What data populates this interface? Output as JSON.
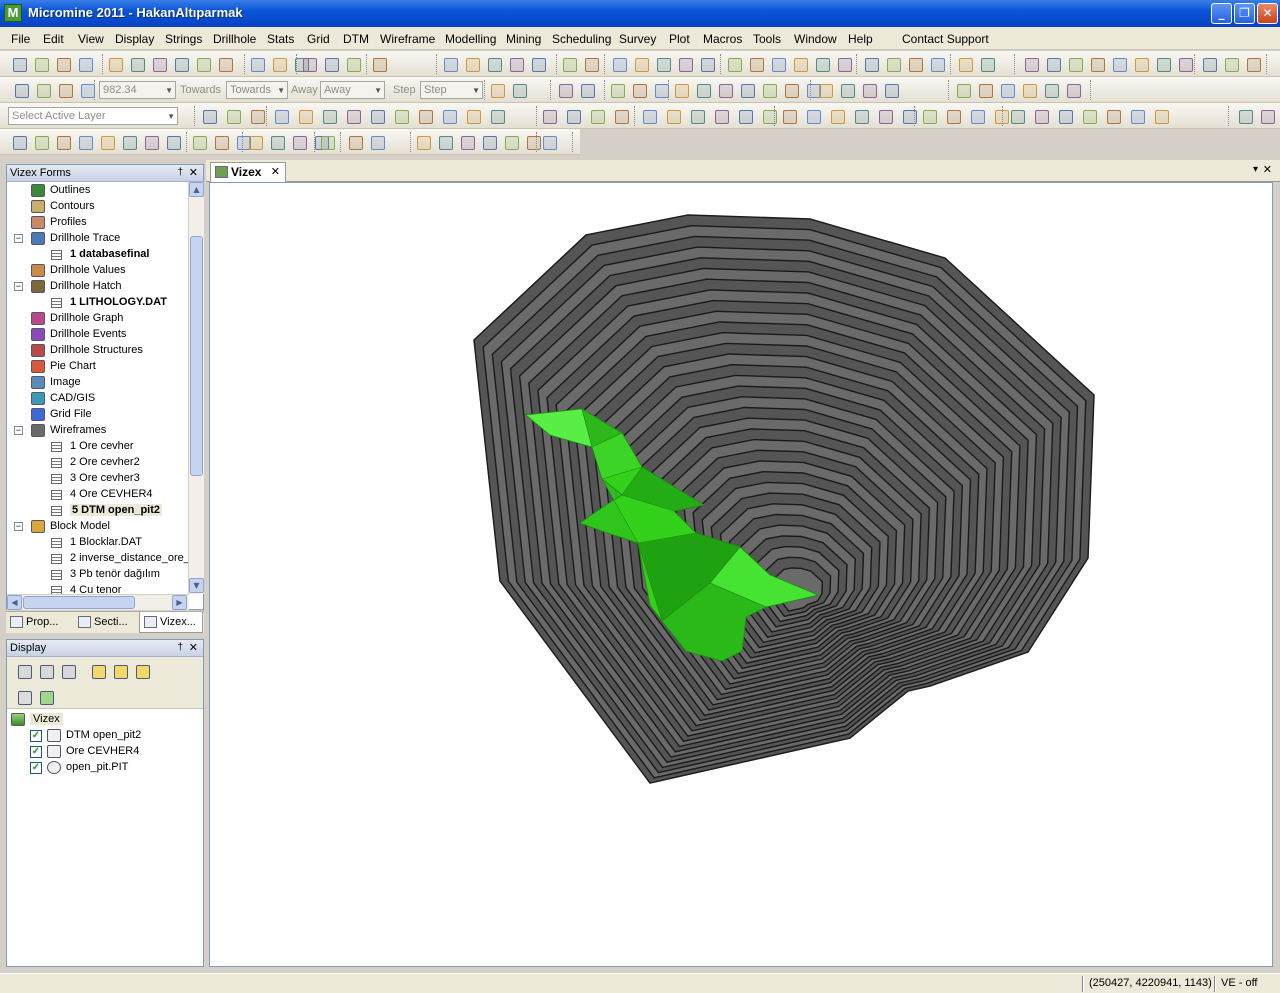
{
  "window": {
    "title": "Micromine 2011 - HakanAltıparmak",
    "app_icon_letter": "M",
    "minimize": "_",
    "maximize": "❐",
    "close": "✕"
  },
  "menu": [
    "File",
    "Edit",
    "View",
    "Display",
    "Strings",
    "Drillhole",
    "Stats",
    "Grid",
    "DTM",
    "Wireframe",
    "Modelling",
    "Mining",
    "Scheduling",
    "Survey",
    "Plot",
    "Macros",
    "Tools",
    "Window",
    "Help",
    "Contact Support"
  ],
  "toolbar": {
    "value_combo": "982.34",
    "towards_label": "Towards",
    "towards_combo": "Towards",
    "away_label": "Away",
    "away_combo": "Away",
    "step_label": "Step",
    "step_combo": "Step",
    "active_layer_placeholder": "Select Active Layer"
  },
  "vizex_forms": {
    "title": "Vizex Forms",
    "pin": "†",
    "close": "✕",
    "items": [
      {
        "label": "Outlines",
        "icon": "outlines-icon"
      },
      {
        "label": "Contours",
        "icon": "contours-icon"
      },
      {
        "label": "Profiles",
        "icon": "profiles-icon"
      },
      {
        "label": "Drillhole Trace",
        "icon": "drillhole-trace-icon",
        "expand": "−"
      },
      {
        "label": "1 databasefinal",
        "child": true,
        "bold": true
      },
      {
        "label": "Drillhole Values",
        "icon": "drillhole-values-icon"
      },
      {
        "label": "Drillhole Hatch",
        "icon": "drillhole-hatch-icon",
        "expand": "−"
      },
      {
        "label": "1 LITHOLOGY.DAT",
        "child": true,
        "bold": true
      },
      {
        "label": "Drillhole Graph",
        "icon": "drillhole-graph-icon"
      },
      {
        "label": "Drillhole Events",
        "icon": "drillhole-events-icon"
      },
      {
        "label": "Drillhole Structures",
        "icon": "drillhole-structures-icon"
      },
      {
        "label": "Pie Chart",
        "icon": "pie-chart-icon"
      },
      {
        "label": "Image",
        "icon": "image-icon"
      },
      {
        "label": "CAD/GIS",
        "icon": "cad-gis-icon"
      },
      {
        "label": "Grid File",
        "icon": "grid-file-icon"
      },
      {
        "label": "Wireframes",
        "icon": "wireframes-icon",
        "expand": "−"
      },
      {
        "label": "1 Ore cevher",
        "child": true
      },
      {
        "label": "2 Ore cevher2",
        "child": true
      },
      {
        "label": "3 Ore cevher3",
        "child": true
      },
      {
        "label": "4 Ore CEVHER4",
        "child": true
      },
      {
        "label": "5 DTM open_pit2",
        "child": true,
        "bold": true,
        "selected": true
      },
      {
        "label": "Block Model",
        "icon": "block-model-icon",
        "expand": "−"
      },
      {
        "label": "1 Blocklar.DAT",
        "child": true
      },
      {
        "label": "2 inverse_distance_ore_",
        "child": true
      },
      {
        "label": "3 Pb tenör dağılım",
        "child": true
      },
      {
        "label": "4 Cu tenor",
        "child": true
      }
    ]
  },
  "left_tabs": [
    "Prop...",
    "Secti...",
    "Vizex..."
  ],
  "display_panel": {
    "title": "Display",
    "pin": "†",
    "close": "✕",
    "root": "Vizex",
    "layers": [
      {
        "label": "DTM open_pit2",
        "checked": "✓"
      },
      {
        "label": "Ore CEVHER4",
        "checked": "✓"
      },
      {
        "label": "open_pit.PIT",
        "checked": "✓"
      }
    ]
  },
  "document": {
    "tab_label": "Vizex",
    "tab_close": "✕",
    "pin_menu": "▾",
    "close": "✕"
  },
  "colors": {
    "pit_fill": "#5a5a5a",
    "pit_bench_line": "#1a1a1a",
    "ore_body": "#33d11c"
  },
  "status": {
    "coords": "(250427, 4220941, 1143)",
    "ve": "VE - off"
  }
}
